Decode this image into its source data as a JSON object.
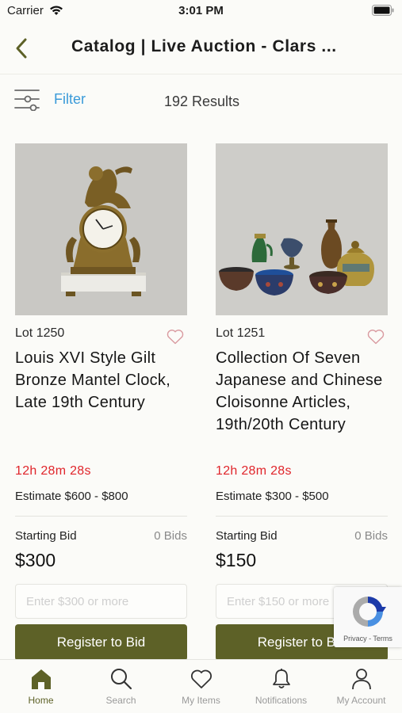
{
  "status_bar": {
    "carrier": "Carrier",
    "time": "3:01 PM"
  },
  "header": {
    "title": "Catalog | Live Auction - Clars ..."
  },
  "filter_bar": {
    "filter_label": "Filter",
    "results": "192 Results"
  },
  "lots": [
    {
      "lot": "Lot 1250",
      "title": "Louis XVI Style Gilt Bronze Mantel Clock, Late 19th Century",
      "countdown": "12h 28m 28s",
      "estimate": "Estimate $600 - $800",
      "starting_label": "Starting Bid",
      "bids": "0 Bids",
      "starting_price": "$300",
      "input_placeholder": "Enter $300 or more",
      "register_label": "Register to Bid"
    },
    {
      "lot": "Lot 1251",
      "title": "Collection Of Seven Japanese and Chinese Cloisonne Articles, 19th/20th Century",
      "countdown": "12h 28m 28s",
      "estimate": "Estimate $300 - $500",
      "starting_label": "Starting Bid",
      "bids": "0 Bids",
      "starting_price": "$150",
      "input_placeholder": "Enter $150 or more",
      "register_label": "Register to Bid"
    }
  ],
  "recaptcha": {
    "links": "Privacy - Terms"
  },
  "tabs": [
    {
      "label": "Home",
      "icon": "home-icon",
      "active": true
    },
    {
      "label": "Search",
      "icon": "search-icon"
    },
    {
      "label": "My Items",
      "icon": "heart-icon"
    },
    {
      "label": "Notifications",
      "icon": "bell-icon"
    },
    {
      "label": "My Account",
      "icon": "person-icon"
    }
  ],
  "colors": {
    "accent": "#5d6127",
    "link": "#3a9ad9",
    "countdown": "#e0252b"
  }
}
